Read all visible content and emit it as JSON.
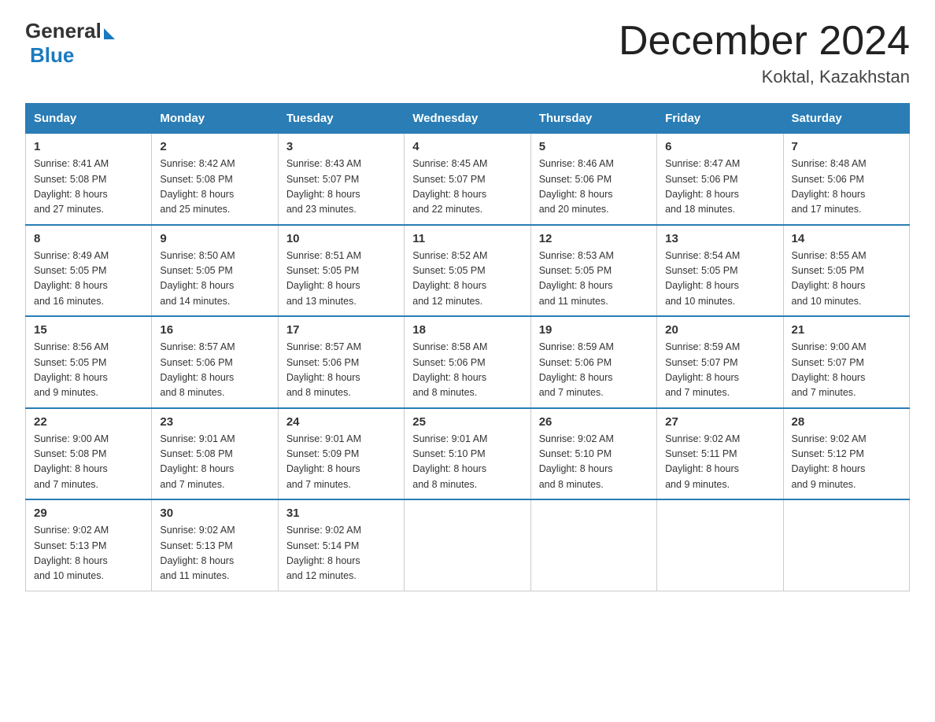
{
  "logo": {
    "general": "General",
    "blue": "Blue"
  },
  "title": "December 2024",
  "subtitle": "Koktal, Kazakhstan",
  "days_of_week": [
    "Sunday",
    "Monday",
    "Tuesday",
    "Wednesday",
    "Thursday",
    "Friday",
    "Saturday"
  ],
  "weeks": [
    [
      {
        "day": "1",
        "sunrise": "8:41 AM",
        "sunset": "5:08 PM",
        "daylight": "8 hours and 27 minutes."
      },
      {
        "day": "2",
        "sunrise": "8:42 AM",
        "sunset": "5:08 PM",
        "daylight": "8 hours and 25 minutes."
      },
      {
        "day": "3",
        "sunrise": "8:43 AM",
        "sunset": "5:07 PM",
        "daylight": "8 hours and 23 minutes."
      },
      {
        "day": "4",
        "sunrise": "8:45 AM",
        "sunset": "5:07 PM",
        "daylight": "8 hours and 22 minutes."
      },
      {
        "day": "5",
        "sunrise": "8:46 AM",
        "sunset": "5:06 PM",
        "daylight": "8 hours and 20 minutes."
      },
      {
        "day": "6",
        "sunrise": "8:47 AM",
        "sunset": "5:06 PM",
        "daylight": "8 hours and 18 minutes."
      },
      {
        "day": "7",
        "sunrise": "8:48 AM",
        "sunset": "5:06 PM",
        "daylight": "8 hours and 17 minutes."
      }
    ],
    [
      {
        "day": "8",
        "sunrise": "8:49 AM",
        "sunset": "5:05 PM",
        "daylight": "8 hours and 16 minutes."
      },
      {
        "day": "9",
        "sunrise": "8:50 AM",
        "sunset": "5:05 PM",
        "daylight": "8 hours and 14 minutes."
      },
      {
        "day": "10",
        "sunrise": "8:51 AM",
        "sunset": "5:05 PM",
        "daylight": "8 hours and 13 minutes."
      },
      {
        "day": "11",
        "sunrise": "8:52 AM",
        "sunset": "5:05 PM",
        "daylight": "8 hours and 12 minutes."
      },
      {
        "day": "12",
        "sunrise": "8:53 AM",
        "sunset": "5:05 PM",
        "daylight": "8 hours and 11 minutes."
      },
      {
        "day": "13",
        "sunrise": "8:54 AM",
        "sunset": "5:05 PM",
        "daylight": "8 hours and 10 minutes."
      },
      {
        "day": "14",
        "sunrise": "8:55 AM",
        "sunset": "5:05 PM",
        "daylight": "8 hours and 10 minutes."
      }
    ],
    [
      {
        "day": "15",
        "sunrise": "8:56 AM",
        "sunset": "5:05 PM",
        "daylight": "8 hours and 9 minutes."
      },
      {
        "day": "16",
        "sunrise": "8:57 AM",
        "sunset": "5:06 PM",
        "daylight": "8 hours and 8 minutes."
      },
      {
        "day": "17",
        "sunrise": "8:57 AM",
        "sunset": "5:06 PM",
        "daylight": "8 hours and 8 minutes."
      },
      {
        "day": "18",
        "sunrise": "8:58 AM",
        "sunset": "5:06 PM",
        "daylight": "8 hours and 8 minutes."
      },
      {
        "day": "19",
        "sunrise": "8:59 AM",
        "sunset": "5:06 PM",
        "daylight": "8 hours and 7 minutes."
      },
      {
        "day": "20",
        "sunrise": "8:59 AM",
        "sunset": "5:07 PM",
        "daylight": "8 hours and 7 minutes."
      },
      {
        "day": "21",
        "sunrise": "9:00 AM",
        "sunset": "5:07 PM",
        "daylight": "8 hours and 7 minutes."
      }
    ],
    [
      {
        "day": "22",
        "sunrise": "9:00 AM",
        "sunset": "5:08 PM",
        "daylight": "8 hours and 7 minutes."
      },
      {
        "day": "23",
        "sunrise": "9:01 AM",
        "sunset": "5:08 PM",
        "daylight": "8 hours and 7 minutes."
      },
      {
        "day": "24",
        "sunrise": "9:01 AM",
        "sunset": "5:09 PM",
        "daylight": "8 hours and 7 minutes."
      },
      {
        "day": "25",
        "sunrise": "9:01 AM",
        "sunset": "5:10 PM",
        "daylight": "8 hours and 8 minutes."
      },
      {
        "day": "26",
        "sunrise": "9:02 AM",
        "sunset": "5:10 PM",
        "daylight": "8 hours and 8 minutes."
      },
      {
        "day": "27",
        "sunrise": "9:02 AM",
        "sunset": "5:11 PM",
        "daylight": "8 hours and 9 minutes."
      },
      {
        "day": "28",
        "sunrise": "9:02 AM",
        "sunset": "5:12 PM",
        "daylight": "8 hours and 9 minutes."
      }
    ],
    [
      {
        "day": "29",
        "sunrise": "9:02 AM",
        "sunset": "5:13 PM",
        "daylight": "8 hours and 10 minutes."
      },
      {
        "day": "30",
        "sunrise": "9:02 AM",
        "sunset": "5:13 PM",
        "daylight": "8 hours and 11 minutes."
      },
      {
        "day": "31",
        "sunrise": "9:02 AM",
        "sunset": "5:14 PM",
        "daylight": "8 hours and 12 minutes."
      },
      null,
      null,
      null,
      null
    ]
  ],
  "labels": {
    "sunrise": "Sunrise:",
    "sunset": "Sunset:",
    "daylight": "Daylight:"
  }
}
